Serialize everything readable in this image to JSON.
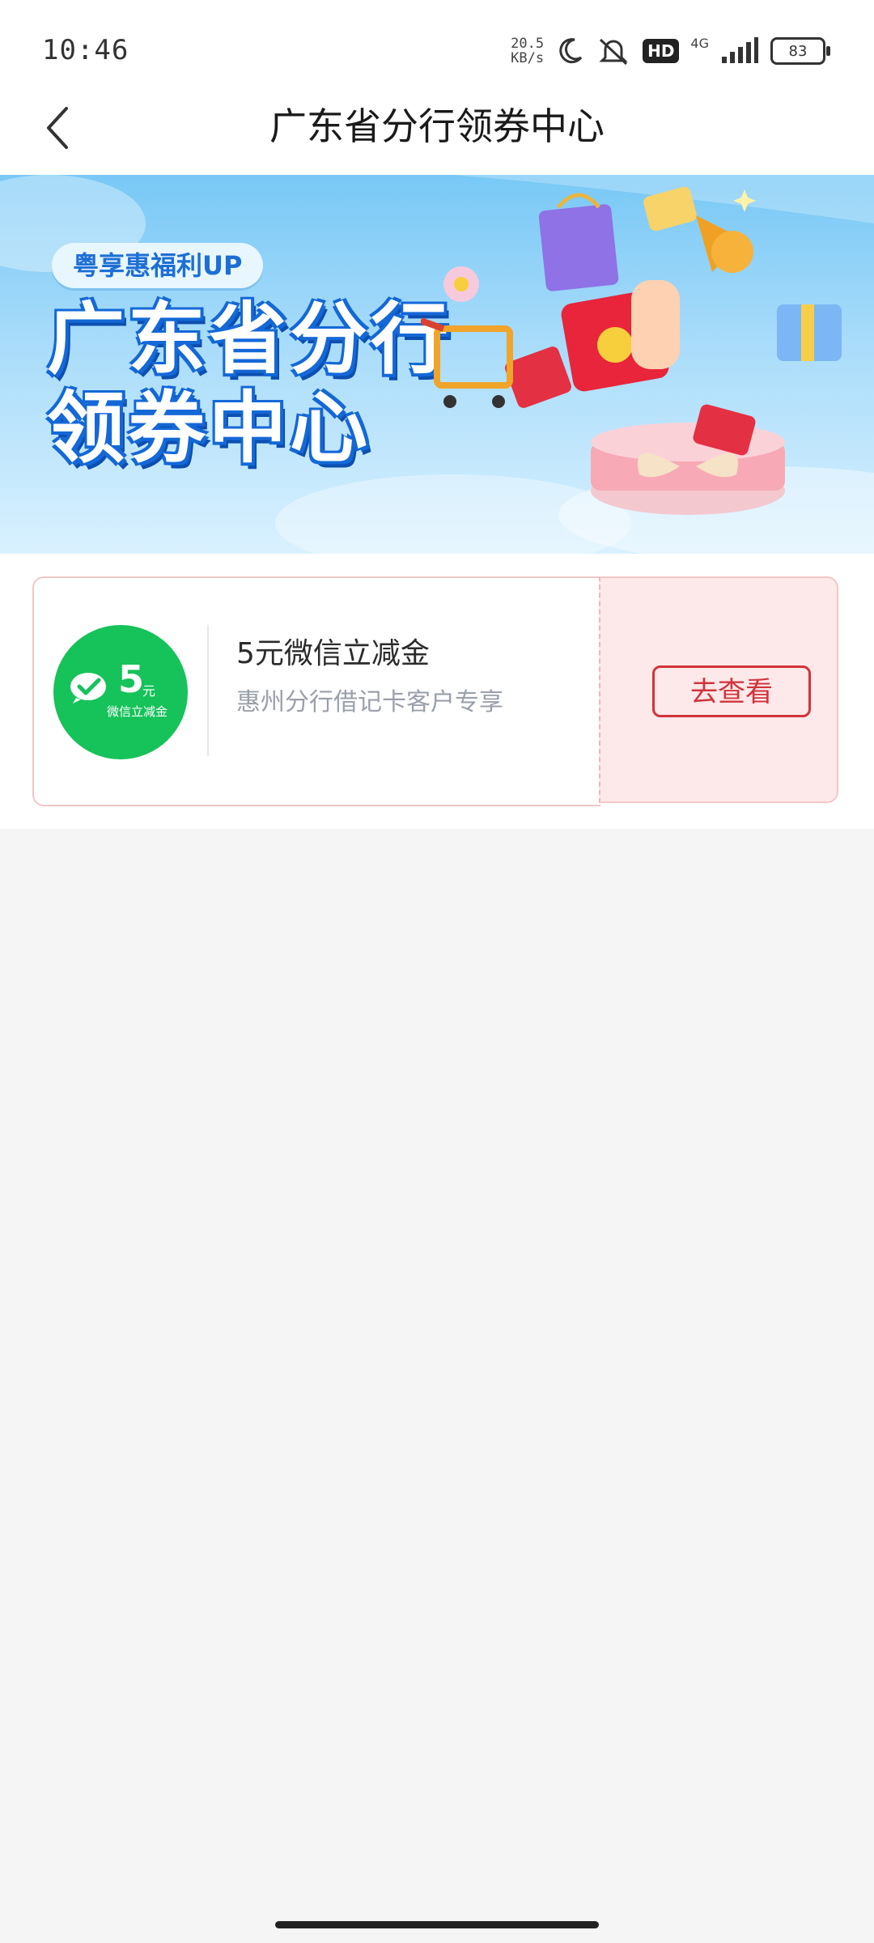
{
  "status_bar": {
    "time": "10:46",
    "net_speed_value": "20.5",
    "net_speed_unit": "KB/s",
    "network": "4G",
    "hd": "HD",
    "battery": "83"
  },
  "header": {
    "title": "广东省分行领券中心"
  },
  "banner": {
    "pill": "粤享惠福利UP",
    "title_line1": "广东省分行",
    "title_line2": "领券中心"
  },
  "coupon": {
    "badge_amount": "5",
    "badge_unit": "元",
    "badge_text": "微信立减金",
    "title": "5元微信立减金",
    "desc": "惠州分行借记卡客户专享",
    "button": "去查看"
  },
  "colors": {
    "accent_red": "#d2333a",
    "wechat_green": "#16c25a",
    "banner_blue": "#78c8f6"
  }
}
